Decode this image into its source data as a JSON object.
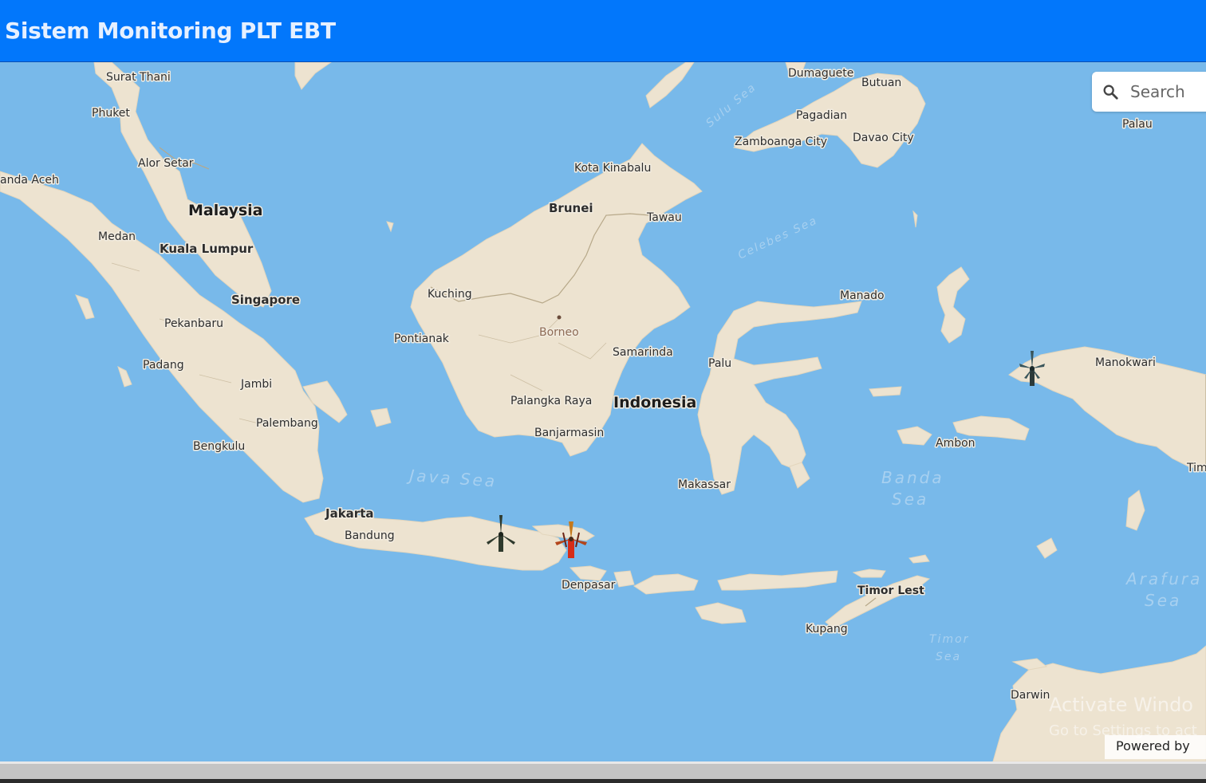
{
  "header": {
    "title": "Sistem Monitoring PLT EBT"
  },
  "search": {
    "placeholder": "Search"
  },
  "map": {
    "countries": [
      "Malaysia",
      "Indonesia",
      "Brunei",
      "Singapore",
      "Timor Lest"
    ],
    "labels": {
      "surat_thani": "Surat Thani",
      "phuket": "Phuket",
      "alor_setar": "Alor Setar",
      "banda_aceh": "anda Aceh",
      "malaysia": "Malaysia",
      "medan": "Medan",
      "kuala_lumpur": "Kuala Lumpur",
      "singapore": "Singapore",
      "pekanbaru": "Pekanbaru",
      "padang": "Padang",
      "jambi": "Jambi",
      "palembang": "Palembang",
      "bengkulu": "Bengkulu",
      "jakarta": "Jakarta",
      "bandung": "Bandung",
      "denpasar": "Denpasar",
      "kota_kinabalu": "Kota Kinabalu",
      "brunei": "Brunei",
      "tawau": "Tawau",
      "kuching": "Kuching",
      "borneo": "Borneo",
      "pontianak": "Pontianak",
      "samarinda": "Samarinda",
      "palangka_raya": "Palangka Raya",
      "indonesia": "Indonesia",
      "banjarmasin": "Banjarmasin",
      "makassar": "Makassar",
      "palu": "Palu",
      "manado": "Manado",
      "dumaguete": "Dumaguete",
      "butuan": "Butuan",
      "pagadian": "Pagadian",
      "zamboanga": "Zamboanga City",
      "davao": "Davao City",
      "palau": "Palau",
      "manokwari": "Manokwari",
      "ambon": "Ambon",
      "timor_leste": "Timor Lest",
      "kupang": "Kupang",
      "darwin": "Darwin",
      "tim": "Tim"
    },
    "seas": {
      "java_sea": "Java Sea",
      "banda_1": "Banda",
      "banda_2": "Sea",
      "arafura_1": "Arafura",
      "arafura_2": "Sea",
      "timor_1": "Timor",
      "timor_2": "Sea",
      "sulu": "Sulu Sea",
      "celebes": "Celebes Sea"
    },
    "markers": [
      {
        "name": "wind-turbine-east-java",
        "status": "normal",
        "color": "#333333"
      },
      {
        "name": "wind-turbine-madura",
        "status": "alert",
        "color": "#d62d18"
      },
      {
        "name": "wind-turbine-papua",
        "status": "normal",
        "color": "#333333"
      }
    ]
  },
  "attribution": {
    "text": "Powered by"
  },
  "watermark": {
    "line1": "Activate Windo",
    "line2": "Go to Settings to act"
  }
}
